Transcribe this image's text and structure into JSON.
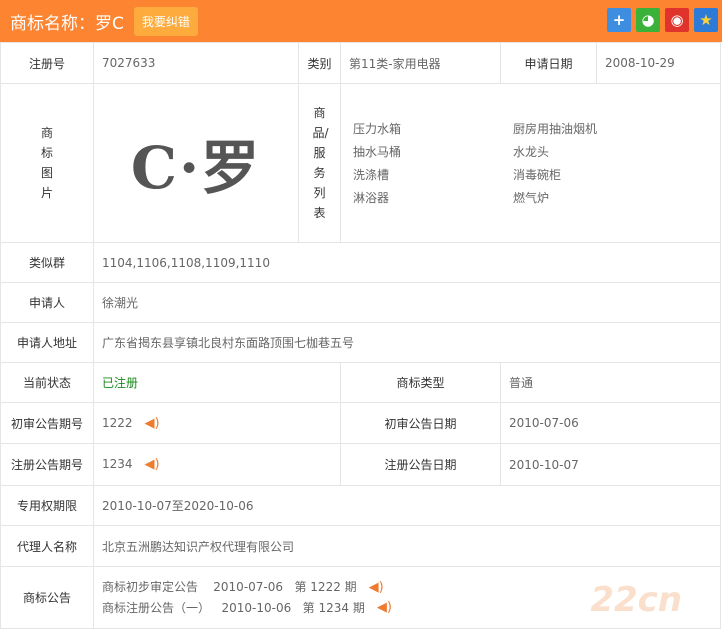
{
  "header": {
    "title": "商标名称：罗C",
    "fix_button": "我要纠错"
  },
  "share_icons": [
    "plus-icon",
    "wechat-icon",
    "weibo-icon",
    "qzone-icon"
  ],
  "reg_no": {
    "label": "注册号",
    "value": "7027633"
  },
  "category": {
    "label": "类别",
    "value": "第11类-家用电器"
  },
  "apply_date": {
    "label": "申请日期",
    "value": "2008-10-29"
  },
  "image": {
    "label": "商标图片",
    "logo_text": "C·罗"
  },
  "goods": {
    "label": "商品/服务列表",
    "items": [
      "压力水箱",
      "厨房用抽油烟机",
      "抽水马桶",
      "水龙头",
      "洗涤槽",
      "消毒碗柜",
      "淋浴器",
      "燃气炉"
    ]
  },
  "similar": {
    "label": "类似群",
    "value": "1104,1106,1108,1109,1110"
  },
  "applicant": {
    "label": "申请人",
    "value": "徐潮光"
  },
  "address": {
    "label": "申请人地址",
    "value": "广东省揭东县享镇北良村东面路顶围七枷巷五号"
  },
  "status": {
    "label": "当前状态",
    "value": "已注册"
  },
  "type": {
    "label": "商标类型",
    "value": "普通"
  },
  "prelim_no": {
    "label": "初审公告期号",
    "value": "1222"
  },
  "prelim_date": {
    "label": "初审公告日期",
    "value": "2010-07-06"
  },
  "reg_pub_no": {
    "label": "注册公告期号",
    "value": "1234"
  },
  "reg_pub_date": {
    "label": "注册公告日期",
    "value": "2010-10-07"
  },
  "exclusive": {
    "label": "专用权期限",
    "value": "2010-10-07至2020-10-06"
  },
  "agent": {
    "label": "代理人名称",
    "value": "北京五洲鹏达知识产权代理有限公司"
  },
  "announce": {
    "label": "商标公告",
    "items": [
      {
        "name": "商标初步审定公告",
        "date": "2010-07-06",
        "issue": "第 1222 期"
      },
      {
        "name": "商标注册公告（一）",
        "date": "2010-10-06",
        "issue": "第 1234 期"
      }
    ]
  },
  "watermark": "22cn",
  "colors": {
    "accent": "#fd8430",
    "status": "#1a8a1a"
  }
}
